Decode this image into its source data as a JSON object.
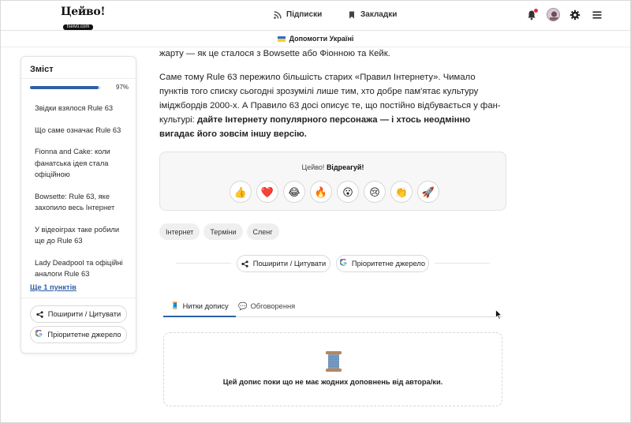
{
  "header": {
    "logo_main": "Цейво!",
    "logo_sub": "tseivo.com",
    "nav_subscriptions": "Підписки",
    "nav_bookmarks": "Закладки"
  },
  "banner": {
    "label": "Допомогти Україні"
  },
  "toc": {
    "title": "Зміст",
    "progress": 0.97,
    "progress_label": "97%",
    "items": [
      "Звідки взялося Rule 63",
      "Що саме означає Rule 63",
      "Fionna and Cake: коли фанатська ідея стала офіційною",
      "Bowsette: Rule 63, яке захопило весь Інтернет",
      "У відеоіграх таке робили ще до Rule 63",
      "Lady Deadpool та офіційні аналоги Rule 63"
    ],
    "more": "Ще 1 пунктів",
    "share_button": "Поширити / Цитувати",
    "source_button": "Пріоритетне джерело"
  },
  "article": {
    "para1": "жарту — як це сталося з Bowsette або Фіонною та Кейк.",
    "para2_plain": "Саме тому Rule 63 пережило більшість старих «Правил Інтернету». Чимало пунктів того списку сьогодні зрозумілі лише тим, хто добре пам'ятає культуру іміджбордів 2000-х. А Правило 63 досі описує те, що постійно відбувається у фан-культурі: ",
    "para2_bold": "дайте Інтернету популярного персонажа — і хтось неодмінно вигадає його зовсім іншу версію."
  },
  "reactions": {
    "label_prefix": "Цейво!",
    "label_bold": "Відреагуй!",
    "emojis": [
      "👍",
      "❤️",
      "😂",
      "🔥",
      "😮",
      "😢",
      "👏",
      "🚀"
    ]
  },
  "tags": [
    "Інтернет",
    "Терміни",
    "Сленг"
  ],
  "share": {
    "share_button": "Поширити / Цитувати",
    "source_button": "Пріоритетне джерело"
  },
  "tabs": {
    "threads_icon": "🧵",
    "threads": "Нитки допису",
    "discussion_icon": "💬",
    "discussion": "Обговорення"
  },
  "empty_state": {
    "icon": "🧵",
    "text": "Цей допис поки що не має жодних доповнень від автора/ки."
  },
  "colors": {
    "accent": "#2f5fa6",
    "notification": "#e0303a"
  }
}
